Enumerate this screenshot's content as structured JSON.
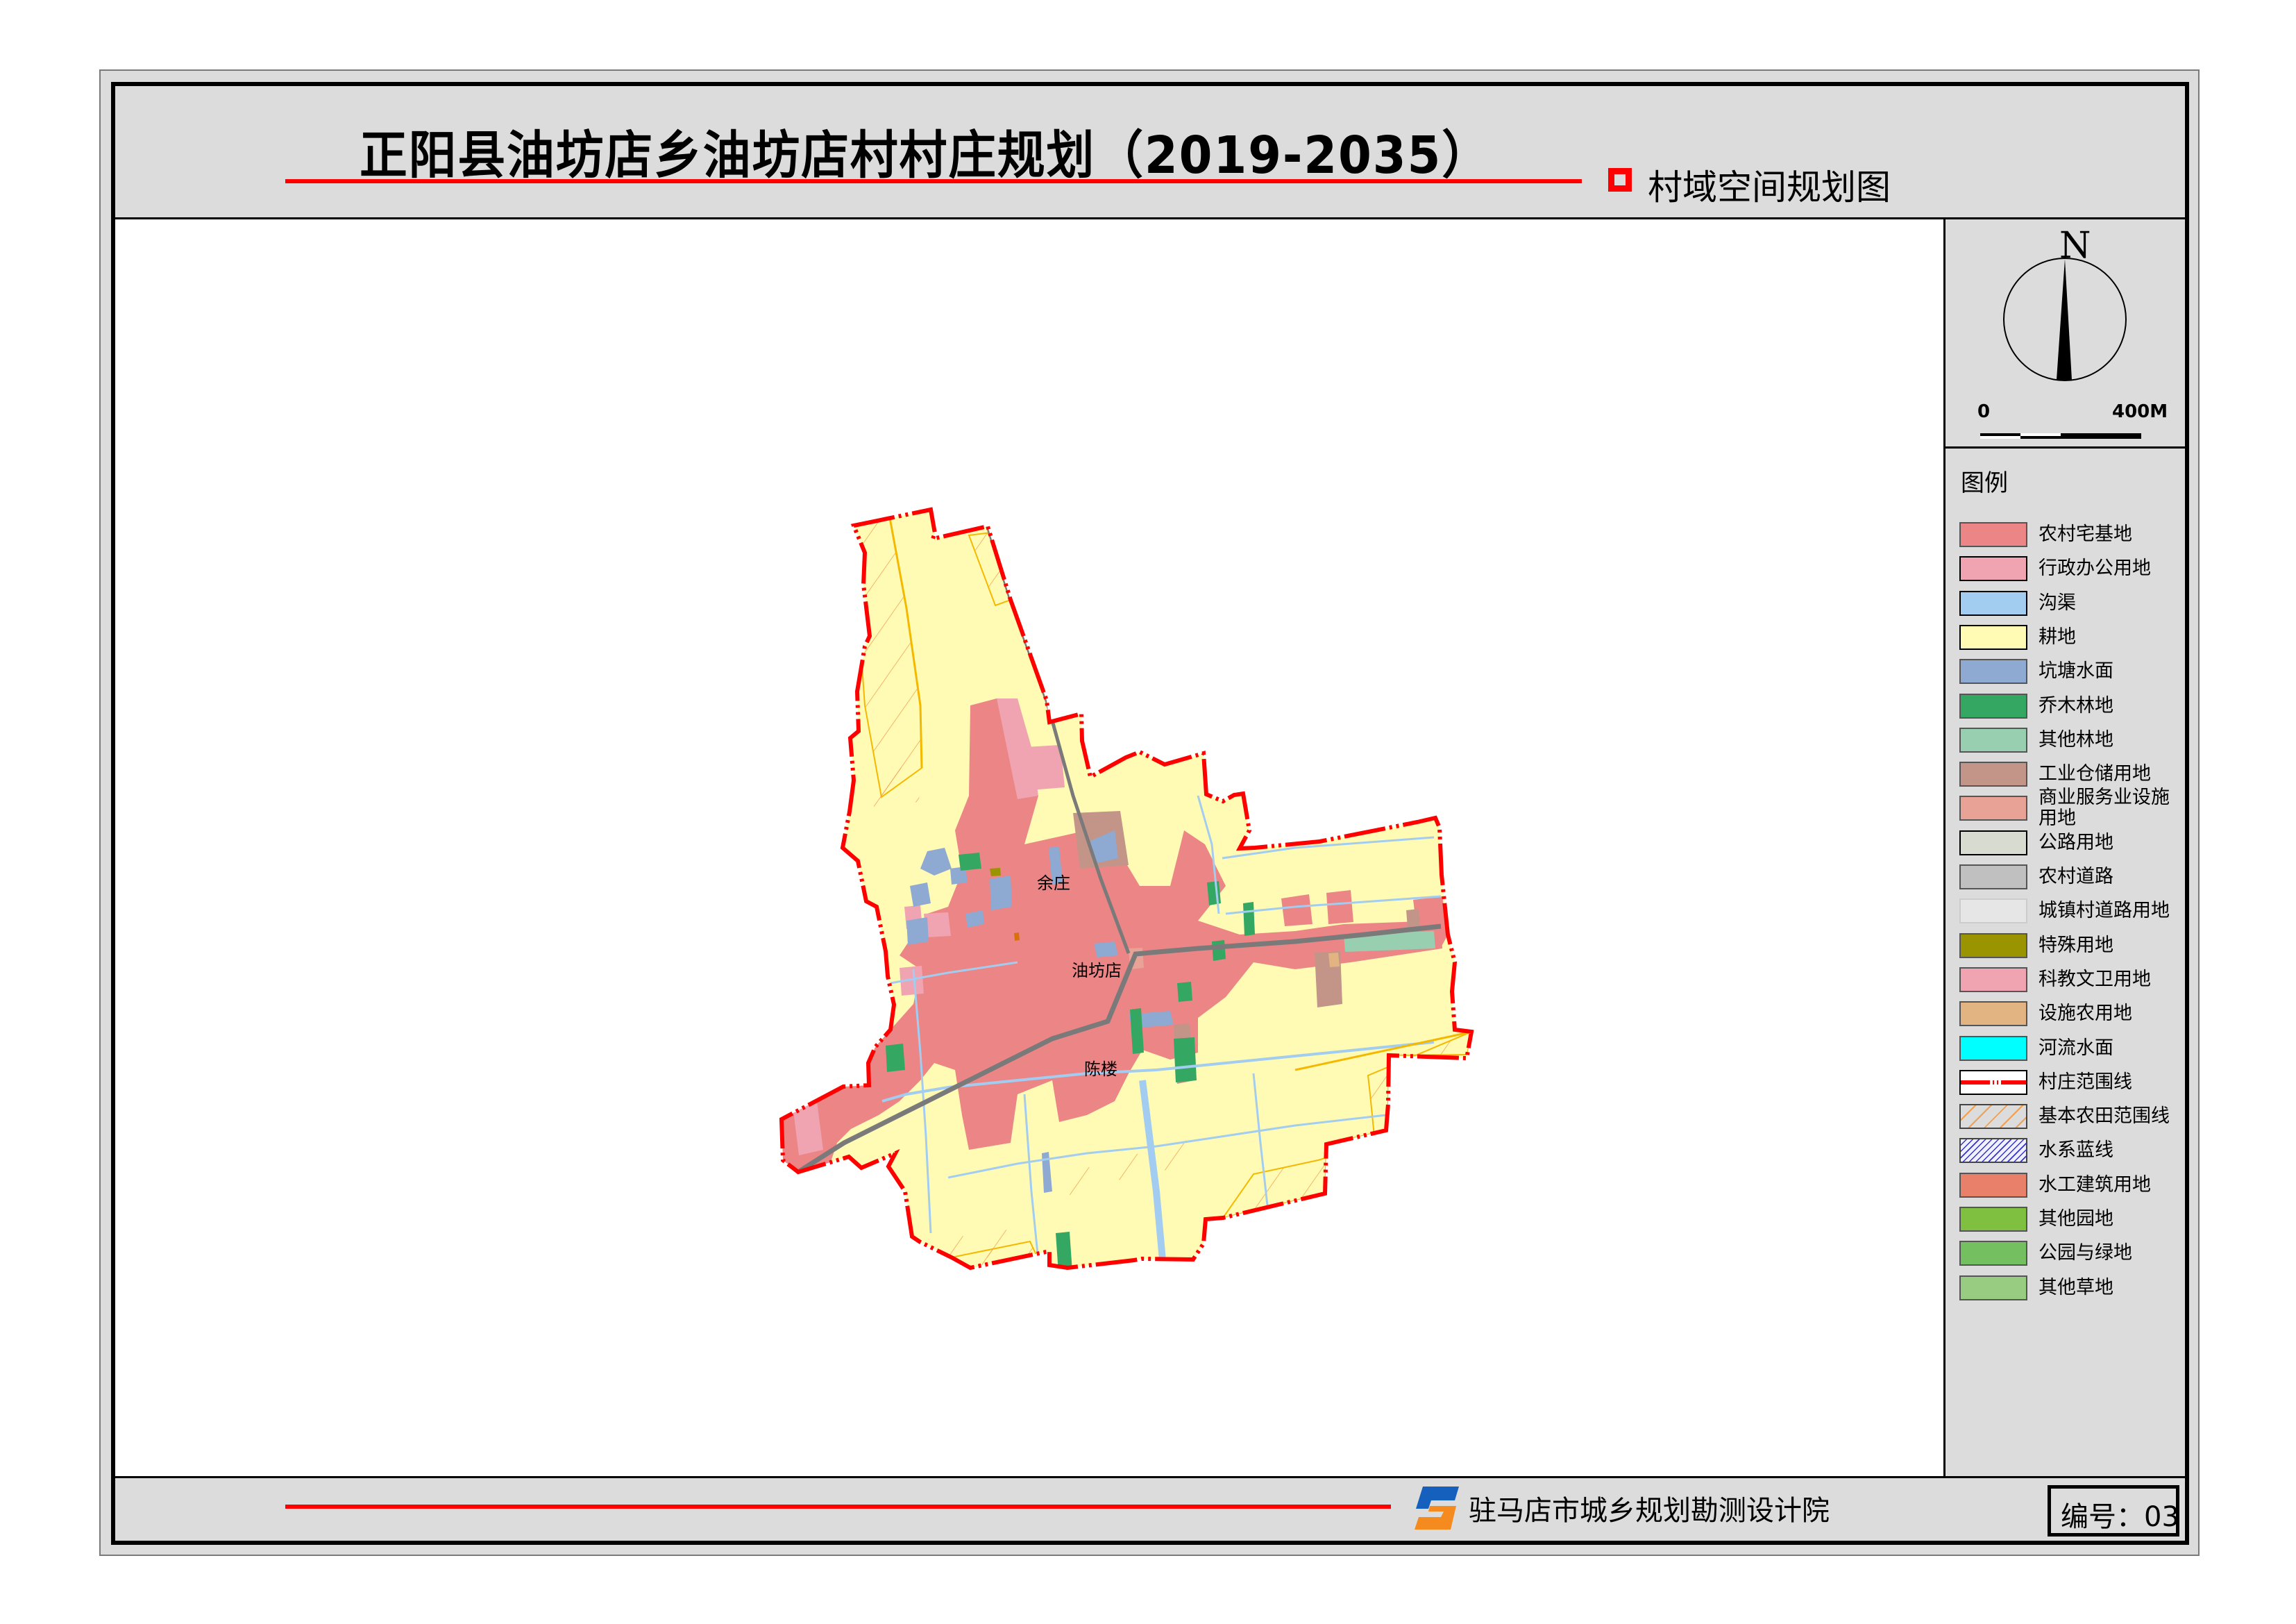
{
  "header": {
    "title": "正阳县油坊店乡油坊店村村庄规划（2019-2035）",
    "subtitle": "村域空间规划图",
    "accent_color": "#ff0000"
  },
  "compass": {
    "north_label": "N",
    "scale_start": "0",
    "scale_end": "400M"
  },
  "legend": {
    "title": "图例",
    "items": [
      {
        "label": "农村宅基地",
        "color": "#ec8585",
        "pattern": "solid"
      },
      {
        "label": "行政办公用地",
        "color": "#f0a3b0",
        "pattern": "solid",
        "border": "#000000"
      },
      {
        "label": "沟渠",
        "color": "#a2cdf0",
        "pattern": "solid",
        "border": "#000000"
      },
      {
        "label": "耕地",
        "color": "#fffbb4",
        "pattern": "solid",
        "border": "#000000"
      },
      {
        "label": "坑塘水面",
        "color": "#8ea9d2",
        "pattern": "solid"
      },
      {
        "label": "乔木林地",
        "color": "#34a862",
        "pattern": "solid"
      },
      {
        "label": "其他林地",
        "color": "#98cfb0",
        "pattern": "solid"
      },
      {
        "label": "工业仓储用地",
        "color": "#c39589",
        "pattern": "solid"
      },
      {
        "label": "商业服务业设施用地",
        "color": "#e8a296",
        "pattern": "solid"
      },
      {
        "label": "公路用地",
        "color": "#d8dcd0",
        "pattern": "solid",
        "border": "#000000"
      },
      {
        "label": "农村道路",
        "color": "#c0c0c0",
        "pattern": "solid"
      },
      {
        "label": "城镇村道路用地",
        "color": "#e6e6e6",
        "pattern": "solid",
        "border": "#cccccc"
      },
      {
        "label": "特殊用地",
        "color": "#999400",
        "pattern": "solid"
      },
      {
        "label": "科教文卫用地",
        "color": "#f0a3b0",
        "pattern": "solid"
      },
      {
        "label": "设施农用地",
        "color": "#e1b482",
        "pattern": "solid"
      },
      {
        "label": "河流水面",
        "color": "#00ffff",
        "pattern": "solid"
      },
      {
        "label": "村庄范围线",
        "color": "#ff0000",
        "pattern": "dashed-line"
      },
      {
        "label": "基本农田范围线",
        "color": "#f0a050",
        "pattern": "hatch"
      },
      {
        "label": "水系蓝线",
        "color": "#3333cc",
        "pattern": "hatch-dense"
      },
      {
        "label": "水工建筑用地",
        "color": "#e8806a",
        "pattern": "solid"
      },
      {
        "label": "其他园地",
        "color": "#80c040",
        "pattern": "solid"
      },
      {
        "label": "公园与绿地",
        "color": "#74c060",
        "pattern": "solid"
      },
      {
        "label": "其他草地",
        "color": "#98cc80",
        "pattern": "solid"
      }
    ]
  },
  "map": {
    "place_labels": [
      "余庄",
      "油坊店",
      "陈楼"
    ],
    "colors": {
      "boundary": "#ff0000",
      "cropland": "#fffbb4",
      "homestead": "#ec8585",
      "pond": "#8ea9d2",
      "ditch": "#a2cdf0",
      "forest": "#34a862",
      "industrial": "#c39589",
      "admin": "#f0a3b0",
      "road": "#7a7a7a",
      "farmland_line": "#f5b800",
      "hatch": "#f0a050",
      "other_forest": "#98cfb0",
      "special": "#999400",
      "facility_ag": "#e1b482",
      "commercial": "#e8a296",
      "water_works": "#d87010"
    }
  },
  "footer": {
    "organization": "驻马店市城乡规划勘测设计院",
    "code_label": "编号：03",
    "logo_colors": {
      "primary": "#1560bd",
      "secondary": "#f58a1f"
    }
  }
}
